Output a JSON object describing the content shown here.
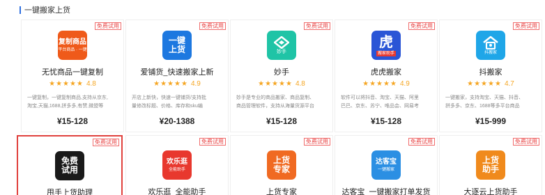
{
  "section": {
    "title": "一键搬家上货"
  },
  "row1": [
    {
      "badge": "免费试用",
      "logo": {
        "lines": [
          "复制商品"
        ],
        "sub": "复制平台商品 · 一键上货",
        "bg": "#ef5a1a",
        "icon": "copy-goods-logo-icon"
      },
      "name": "无忧商品一键复制",
      "stars": "★★★★★",
      "score": "4.8",
      "desc": [
        "一键复制，一键复制商品,支持从京东,",
        "淘宝,天猫,1688,拼多多,有赞,微盟等"
      ],
      "price": "¥15-128"
    },
    {
      "badge": "免费试用",
      "logo": {
        "lines": [
          "一键",
          "上货"
        ],
        "sub": "",
        "bg": "#1d78e0",
        "icon": "one-click-upload-logo-icon"
      },
      "name": "爱铺货_快速搬家上新",
      "stars": "★★★★★",
      "score": "4.9",
      "desc": [
        "开店上新快，快速一键铺货/支持批",
        "量修改标题、价格、库存和sku编"
      ],
      "price": "¥20-1388"
    },
    {
      "badge": "免费试用",
      "logo": {
        "lines": [
          "妙手"
        ],
        "sub": "",
        "bg": "#1fc4a6",
        "icon": "miaoshou-logo-icon"
      },
      "name": "妙手",
      "stars": "★★★★★",
      "score": "4.8",
      "desc": [
        "妙手是专业的商品搬家、商品复制、",
        "商品管理软件，支持从海量货源平台"
      ],
      "price": "¥15-128"
    },
    {
      "badge": "免费试用",
      "logo": {
        "lines": [
          "虎"
        ],
        "sub": "搬家助手",
        "bg": "#2a55d6",
        "icon": "tiger-logo-icon"
      },
      "name": "虎虎搬家",
      "stars": "★★★★★",
      "score": "4.9",
      "desc": [
        "软件可以将抖音、淘宝、天猫、阿里",
        "巴巴、京东、苏宁、唯品会、网易考"
      ],
      "price": "¥15-128"
    },
    {
      "badge": "免费试用",
      "logo": {
        "lines": [
          "⌂"
        ],
        "sub": "抖搬家",
        "bg": "#1fa6e8",
        "icon": "house-logo-icon"
      },
      "name": "抖搬家",
      "stars": "★★★★★",
      "score": "4.7",
      "desc": [
        "一键搬家，支持淘宝、天猫、抖音、",
        "拼多多、京东、1688等多平台商品"
      ],
      "price": "¥15-999"
    }
  ],
  "row2": [
    {
      "badge": "免费试用",
      "logo": {
        "lines": [
          "免费",
          "试用"
        ],
        "sub": "",
        "bg": "#1a1a1a",
        "icon": "free-trial-logo-icon"
      },
      "name": "甩手上货助理"
    },
    {
      "badge": "免费试用",
      "logo": {
        "lines": [
          "欢乐逛"
        ],
        "sub": "全能助手",
        "bg": "#e8382e",
        "icon": "huanleguang-logo-icon"
      },
      "name": "欢乐逛_全能助手"
    },
    {
      "badge": "免费试用",
      "logo": {
        "lines": [
          "上货",
          "专家"
        ],
        "sub": "",
        "bg": "#f06a22",
        "icon": "upload-expert-logo-icon"
      },
      "name": "上货专家"
    },
    {
      "badge": "免费试用",
      "logo": {
        "lines": [
          "达客宝"
        ],
        "sub": "一键搬家",
        "bg": "#2b8fe3",
        "icon": "dakebao-logo-icon"
      },
      "name": "达客宝_一键搬家打单发货"
    },
    {
      "badge": "免费试用",
      "logo": {
        "lines": [
          "上货",
          "助手"
        ],
        "sub": "",
        "bg": "#f08a1c",
        "icon": "upload-helper-logo-icon"
      },
      "name": "大逐云上货助手"
    }
  ]
}
